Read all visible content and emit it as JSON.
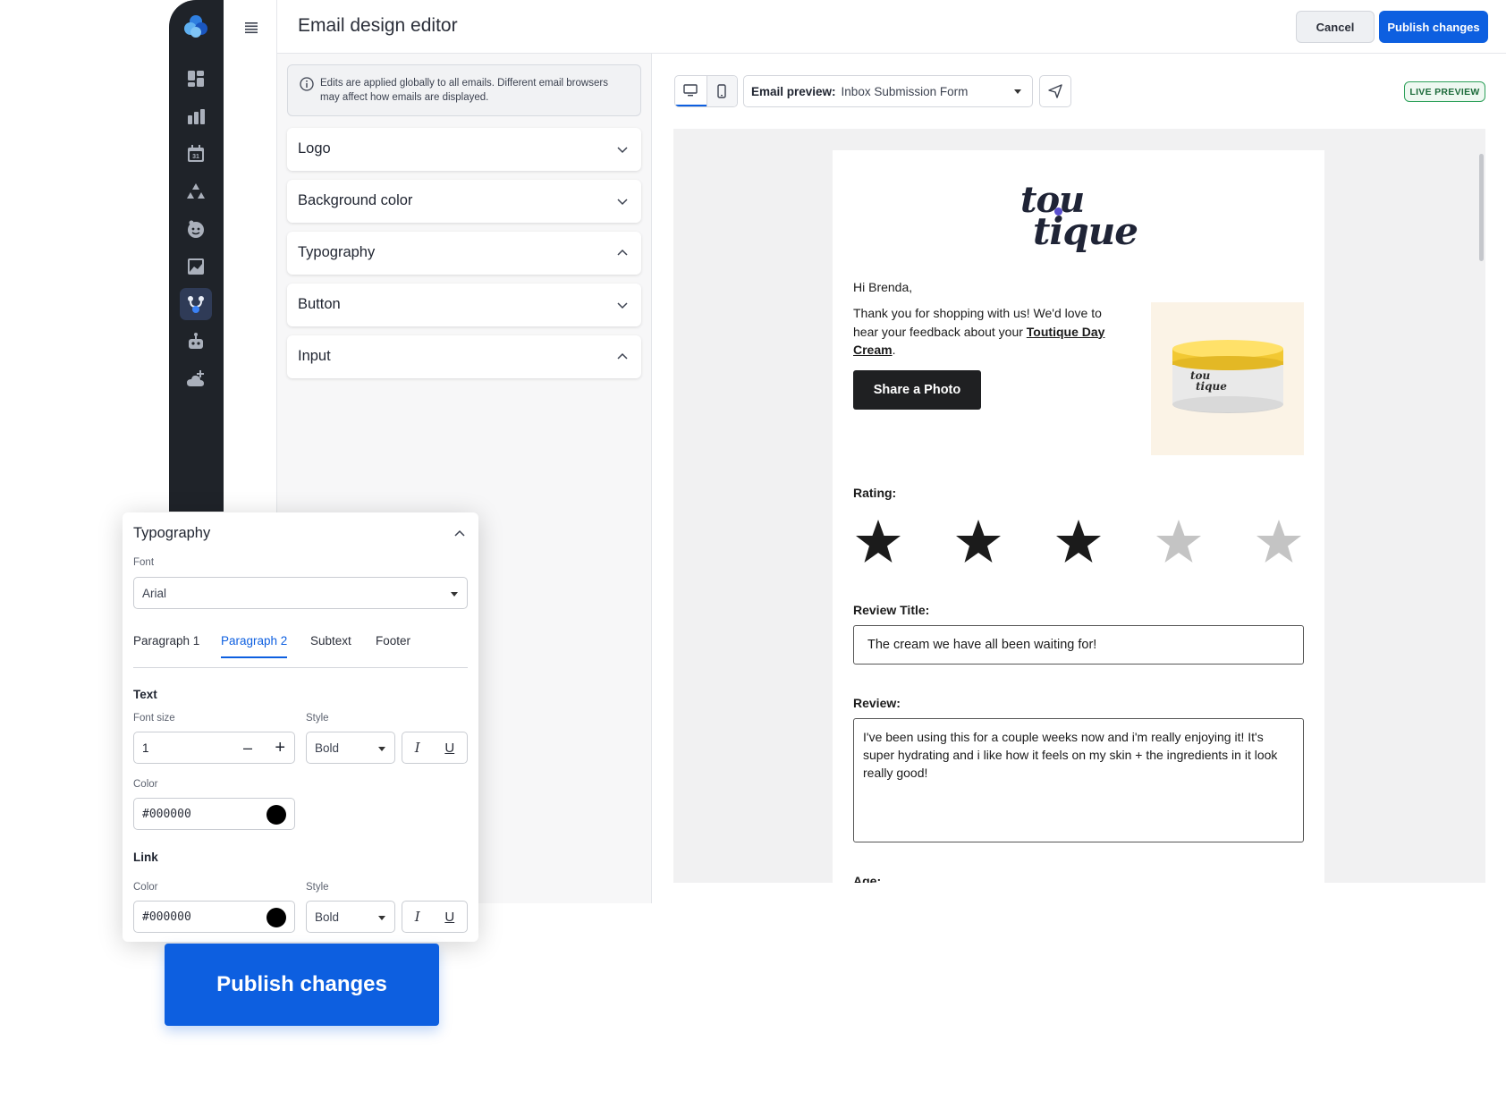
{
  "header": {
    "title": "Email design editor",
    "cancel_label": "Cancel",
    "publish_label": "Publish changes"
  },
  "sidebar": {
    "icons": [
      "dashboard-icon",
      "chart-icon",
      "calendar-icon",
      "network-icon",
      "face-icon",
      "image-icon",
      "flow-icon",
      "robot-icon",
      "cloud-add-icon"
    ],
    "calendar_day": "31",
    "active_index": 6
  },
  "settings": {
    "notice": "Edits are applied globally to all emails. Different email browsers may affect how emails are displayed.",
    "sections": [
      {
        "label": "Logo",
        "expanded": false
      },
      {
        "label": "Background color",
        "expanded": false
      },
      {
        "label": "Typography",
        "expanded": true
      },
      {
        "label": "Button",
        "expanded": false
      },
      {
        "label": "Input",
        "expanded": true
      }
    ]
  },
  "preview": {
    "preview_label": "Email preview:",
    "preview_value": "Inbox Submission Form",
    "live_badge": "LIVE PREVIEW",
    "email": {
      "brand_line1": "tou",
      "brand_line2": "tique",
      "greeting": "Hi Brenda,",
      "intro_before": "Thank you for shopping with us! We'd love to hear your feedback about your ",
      "intro_link": "Toutique Day Cream",
      "intro_after": ".",
      "share_button": "Share a Photo",
      "product_label_1": "tou",
      "product_label_2": "tique",
      "rating_label": "Rating:",
      "rating": 3,
      "rating_max": 5,
      "review_title_label": "Review Title:",
      "review_title_value": "The cream we have all been waiting for!",
      "review_label": "Review:",
      "review_value": "I've been using this for a couple weeks now and i'm really enjoying it! It's super hydrating and i like how it feels on my skin + the ingredients in it look really good!",
      "age_label": "Age:"
    }
  },
  "typography_panel": {
    "title": "Typography",
    "font_label": "Font",
    "font_value": "Arial",
    "tabs": [
      "Paragraph 1",
      "Paragraph 2",
      "Subtext",
      "Footer"
    ],
    "active_tab": "Paragraph 2",
    "text_section": "Text",
    "font_size_label": "Font size",
    "font_size_value": "1",
    "style_label": "Style",
    "style_value": "Bold",
    "color_label": "Color",
    "text_color": "#000000",
    "link_section": "Link",
    "link_color_label": "Color",
    "link_color": "#000000",
    "link_style_label": "Style",
    "link_style_value": "Bold"
  },
  "cta": {
    "publish_label": "Publish changes"
  },
  "colors": {
    "accent": "#0d5fe0",
    "rail": "#1f2329",
    "live_green": "#2ea15a",
    "star_on": "#1b1b1b",
    "star_off": "#c4c4c4"
  }
}
